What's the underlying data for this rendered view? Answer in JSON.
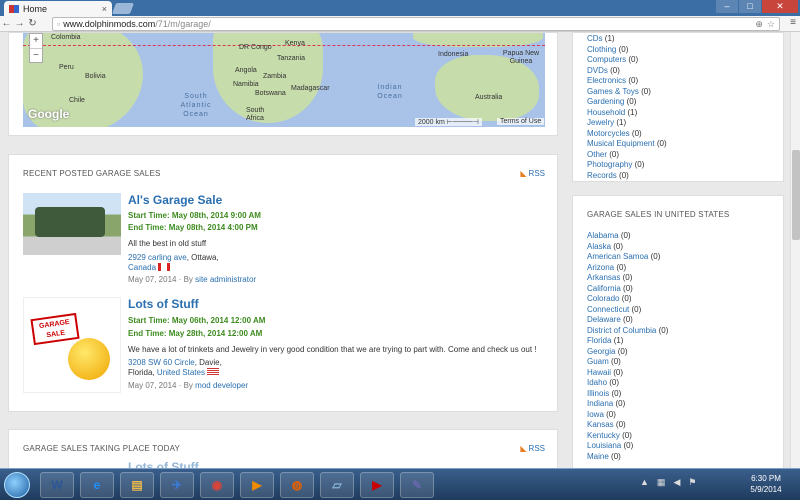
{
  "browser": {
    "tab_title": "Home",
    "url_host": "www.dolphinmods.com",
    "url_path": "/71/m/garage/"
  },
  "map": {
    "labels": [
      "Colombia",
      "Peru",
      "Bolivia",
      "Chile",
      "DR Congo",
      "Kenya",
      "Tanzania",
      "Angola",
      "Zambia",
      "Namibia",
      "Botswana",
      "South Africa",
      "Madagascar",
      "Indonesia",
      "Papua New Guinea",
      "Australia"
    ],
    "oceans": [
      "South Atlantic Ocean",
      "Indian Ocean"
    ],
    "google": "Google",
    "scale": "2000 km",
    "terms": "Terms of Use"
  },
  "recent": {
    "heading": "RECENT POSTED GARAGE SALES",
    "rss": "RSS",
    "items": [
      {
        "title": "Al's Garage Sale",
        "start": "Start Time: May 08th, 2014 9:00 AM",
        "end": "End Time: May 08th, 2014 4:00 PM",
        "desc": "All the best in old stuff",
        "street": "2929 carling ave",
        "city": ", Ottawa,",
        "country": "Canada",
        "date": "May 07, 2014",
        "by": "By",
        "author": "site administrator"
      },
      {
        "title": "Lots of Stuff",
        "start": "Start Time: May 06th, 2014 12:00 AM",
        "end": "End Time: May 28th, 2014 12:00 AM",
        "desc": "We have a lot of trinkets and Jewelry in very good condition that we are trying to part with. Come and check us out !",
        "street": "3208 SW 60 Circle",
        "city": ", Davie,",
        "region": "Florida,",
        "country": "United States",
        "date": "May 07, 2014",
        "by": "By",
        "author": "mod developer",
        "sign_text": "GARAGE SALE"
      }
    ]
  },
  "today": {
    "heading": "GARAGE SALES TAKING PLACE TODAY",
    "rss": "RSS",
    "partial_title": "Lots of Stuff"
  },
  "categories": [
    {
      "name": "CDs",
      "count": "(1)"
    },
    {
      "name": "Clothing",
      "count": "(0)"
    },
    {
      "name": "Computers",
      "count": "(0)"
    },
    {
      "name": "DVDs",
      "count": "(0)"
    },
    {
      "name": "Electronics",
      "count": "(0)"
    },
    {
      "name": "Games & Toys",
      "count": "(0)"
    },
    {
      "name": "Gardening",
      "count": "(0)"
    },
    {
      "name": "Household",
      "count": "(1)"
    },
    {
      "name": "Jewelry",
      "count": "(1)"
    },
    {
      "name": "Motorcycles",
      "count": "(0)"
    },
    {
      "name": "Musical Equipment",
      "count": "(0)"
    },
    {
      "name": "Other",
      "count": "(0)"
    },
    {
      "name": "Photography",
      "count": "(0)"
    },
    {
      "name": "Records",
      "count": "(0)"
    }
  ],
  "states_heading": "GARAGE SALES IN UNITED STATES",
  "states": [
    {
      "name": "Alabama",
      "count": "(0)"
    },
    {
      "name": "Alaska",
      "count": "(0)"
    },
    {
      "name": "American Samoa",
      "count": "(0)"
    },
    {
      "name": "Arizona",
      "count": "(0)"
    },
    {
      "name": "Arkansas",
      "count": "(0)"
    },
    {
      "name": "California",
      "count": "(0)"
    },
    {
      "name": "Colorado",
      "count": "(0)"
    },
    {
      "name": "Connecticut",
      "count": "(0)"
    },
    {
      "name": "Delaware",
      "count": "(0)"
    },
    {
      "name": "District of Columbia",
      "count": "(0)"
    },
    {
      "name": "Florida",
      "count": "(1)"
    },
    {
      "name": "Georgia",
      "count": "(0)"
    },
    {
      "name": "Guam",
      "count": "(0)"
    },
    {
      "name": "Hawaii",
      "count": "(0)"
    },
    {
      "name": "Idaho",
      "count": "(0)"
    },
    {
      "name": "Illinois",
      "count": "(0)"
    },
    {
      "name": "Indiana",
      "count": "(0)"
    },
    {
      "name": "Iowa",
      "count": "(0)"
    },
    {
      "name": "Kansas",
      "count": "(0)"
    },
    {
      "name": "Kentucky",
      "count": "(0)"
    },
    {
      "name": "Louisiana",
      "count": "(0)"
    },
    {
      "name": "Maine",
      "count": "(0)"
    }
  ],
  "taskbar": {
    "time": "6:30 PM",
    "date": "5/9/2014",
    "apps": [
      "word-icon",
      "ie-icon",
      "explorer-icon",
      "media-center-icon",
      "chrome-icon",
      "media-player-icon",
      "firefox-icon",
      "notepad-icon",
      "youtube-icon",
      "paint-icon"
    ]
  },
  "colors": {
    "link": "#2a6fb0",
    "time_green": "#3d8b1f",
    "rss_orange": "#e67e22",
    "map_water": "#a9c3e8",
    "map_land": "#c7dcab"
  }
}
